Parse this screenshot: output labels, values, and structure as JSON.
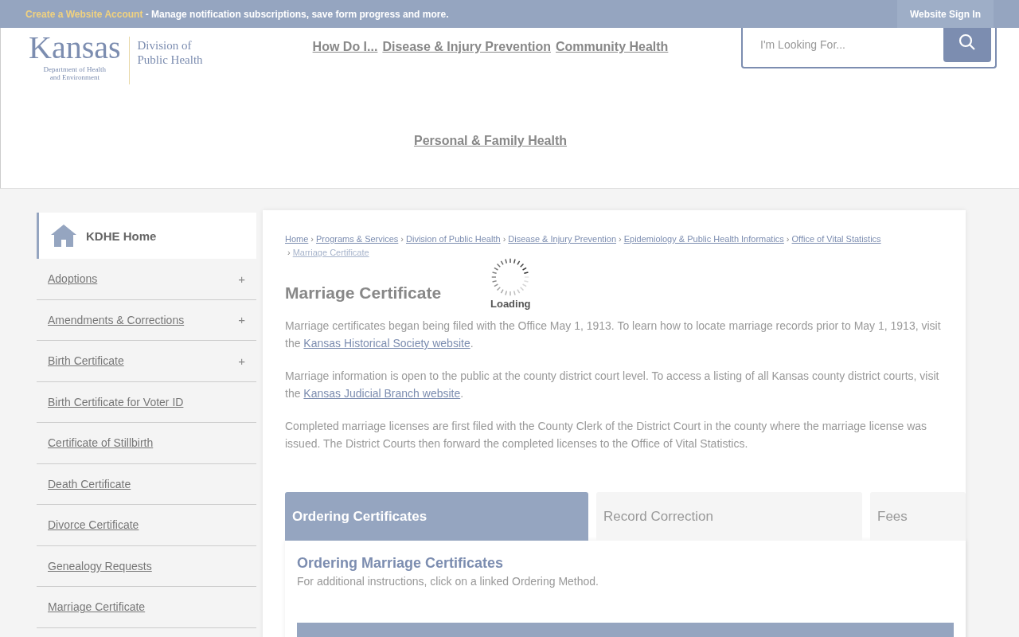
{
  "top_bar": {
    "account_link": "Create a Website Account",
    "message": "- Manage notification subscriptions, save form progress and more.",
    "sign_in": "Website Sign In"
  },
  "logo": {
    "name": "Kansas",
    "department": [
      "Department of Health",
      "and Environment"
    ],
    "division": [
      "Division of",
      "Public Health"
    ]
  },
  "nav": [
    "How Do I...",
    "Disease & Injury Prevention",
    "Community Health",
    "Personal & Family Health"
  ],
  "search": {
    "placeholder": "I'm Looking For..."
  },
  "sidebar": {
    "home": "KDHE Home",
    "items": [
      {
        "label": "Adoptions",
        "toggle": "+"
      },
      {
        "label": "Amendments & Corrections",
        "toggle": "+"
      },
      {
        "label": "Birth Certificate",
        "toggle": "+"
      },
      {
        "label": "Birth Certificate for Voter ID"
      },
      {
        "label": "Certificate of Stillbirth"
      },
      {
        "label": "Death Certificate"
      },
      {
        "label": "Divorce Certificate"
      },
      {
        "label": "Genealogy Requests"
      },
      {
        "label": "Marriage Certificate"
      }
    ]
  },
  "breadcrumbs": [
    {
      "label": "Home",
      "current": false
    },
    {
      "separator": "›",
      "label": "Programs & Services",
      "current": false
    },
    {
      "separator": "›",
      "label": "Division of Public Health",
      "current": false
    },
    {
      "separator": "›",
      "label": "Disease & Injury Prevention",
      "current": false
    },
    {
      "separator": "›",
      "label": "Epidemiology & Public Health Informatics",
      "current": false
    },
    {
      "separator": "›",
      "label": "Office of Vital Statistics",
      "current": false
    },
    {
      "separator": "›",
      "label": "Marriage Certificate",
      "current": true
    }
  ],
  "title": "Marriage Certificate",
  "paragraphs": [
    [
      {
        "kind": "text",
        "text": "Marriage certificates began being filed with the Office May 1, 1913. To learn how to locate marriage records prior to May 1, 1913, visit the "
      },
      {
        "kind": "link",
        "text": "Kansas Historical Society website"
      },
      {
        "kind": "text",
        "text": "."
      }
    ],
    [
      {
        "kind": "text",
        "text": "Marriage information is open to the public at the county district court level. To access a listing of all Kansas county district courts, visit the "
      },
      {
        "kind": "link",
        "text": "Kansas Judicial Branch website"
      },
      {
        "kind": "text",
        "text": "."
      }
    ],
    [
      {
        "kind": "text",
        "text": "Completed marriage licenses are first filed with the County Clerk of the District Court in the county where the marriage license was issued. The District Courts then forward the completed licenses to the Office of Vital Statistics."
      }
    ]
  ],
  "loading": "Loading",
  "tabs": [
    {
      "label": "Ordering Certificates",
      "selected": true
    },
    {
      "label": "Record Correction",
      "selected": false
    },
    {
      "label": "Fees",
      "selected": false
    }
  ],
  "panel": {
    "heading": "Ordering Marriage Certificates",
    "instructions": "For additional instructions, click on a linked Ordering Method."
  }
}
